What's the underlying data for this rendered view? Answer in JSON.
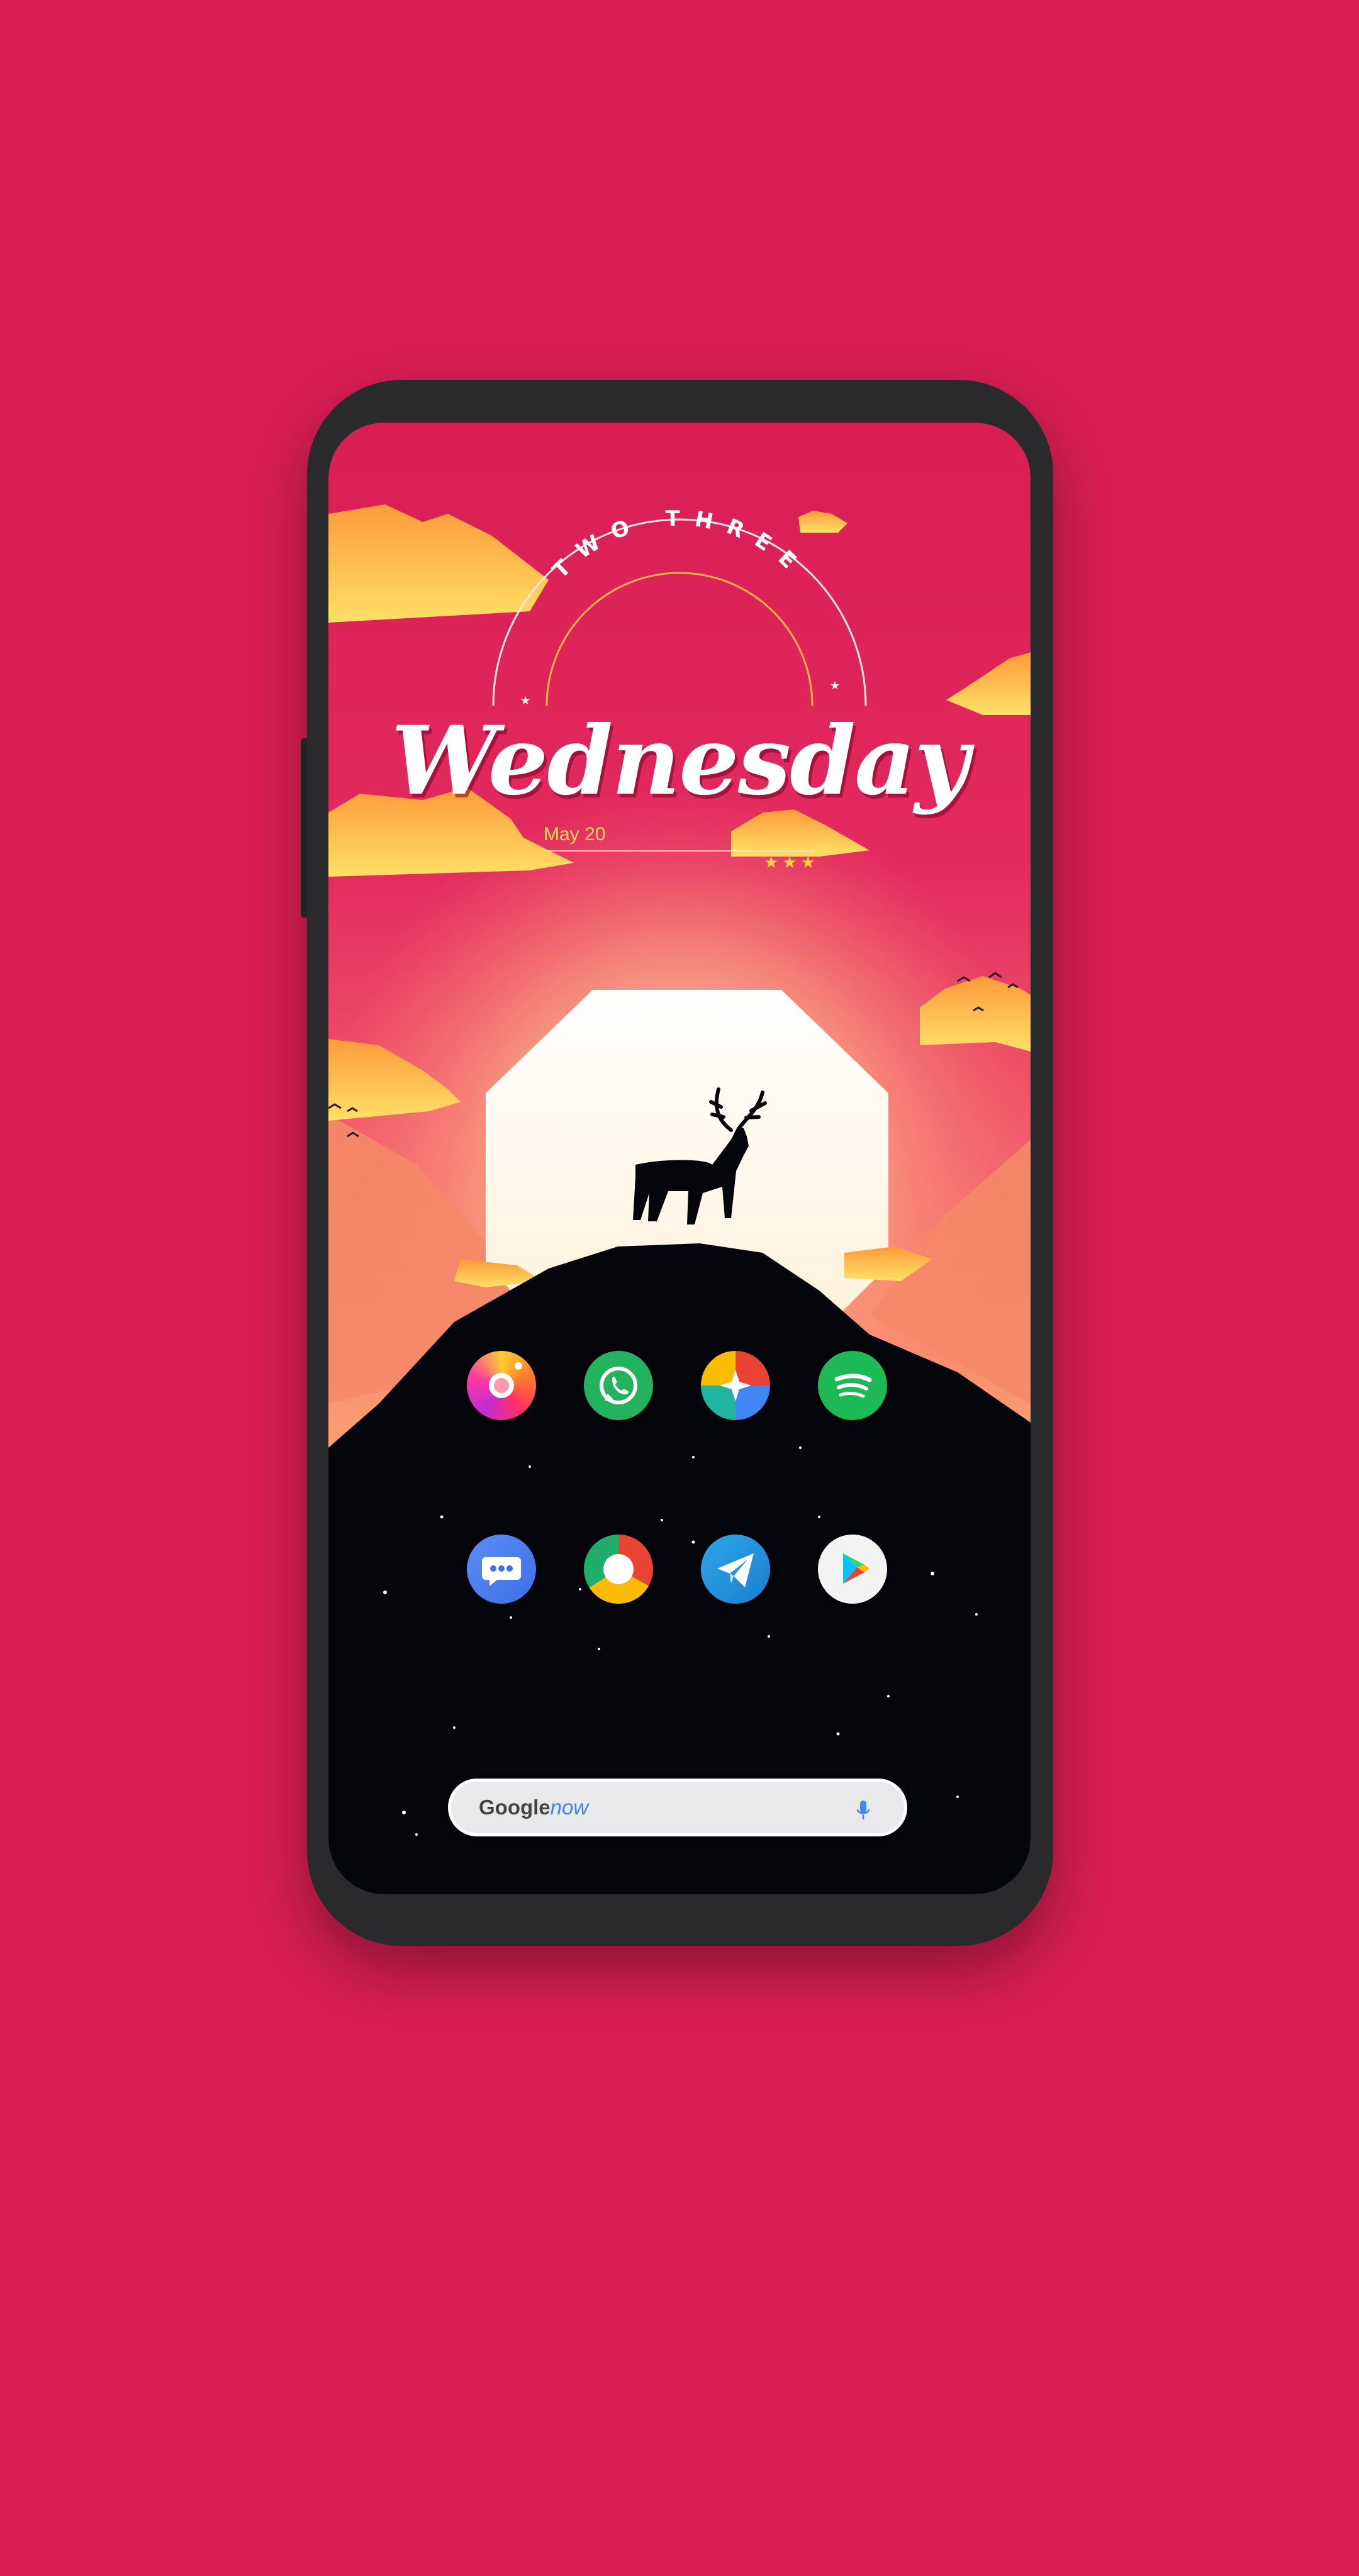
{
  "colors": {
    "background": "#d81e54",
    "phone_frame": "#2a2a2c",
    "sky_top": "#d81e54",
    "sun": "#ffffff",
    "clouds": "#ffc94a",
    "mountain": "#05050c"
  },
  "widget": {
    "arc_text": "TWO THREE",
    "day": "Wednesday",
    "date": "May 20",
    "stars": "★★★"
  },
  "dock": {
    "row1": [
      {
        "name": "camera-app",
        "icon": "camera-lens-icon"
      },
      {
        "name": "whatsapp-app",
        "icon": "phone-call-icon"
      },
      {
        "name": "photos-app",
        "icon": "sparkle-icon"
      },
      {
        "name": "spotify-app",
        "icon": "spotify-icon"
      }
    ],
    "row2": [
      {
        "name": "messages-app",
        "icon": "chat-bubble-icon"
      },
      {
        "name": "chrome-app",
        "icon": "chrome-icon"
      },
      {
        "name": "telegram-app",
        "icon": "paper-plane-icon"
      },
      {
        "name": "play-store-app",
        "icon": "play-triangle-icon"
      }
    ]
  },
  "search": {
    "brand": "Google",
    "brand_suffix": "now",
    "icon": "microphone-icon"
  }
}
